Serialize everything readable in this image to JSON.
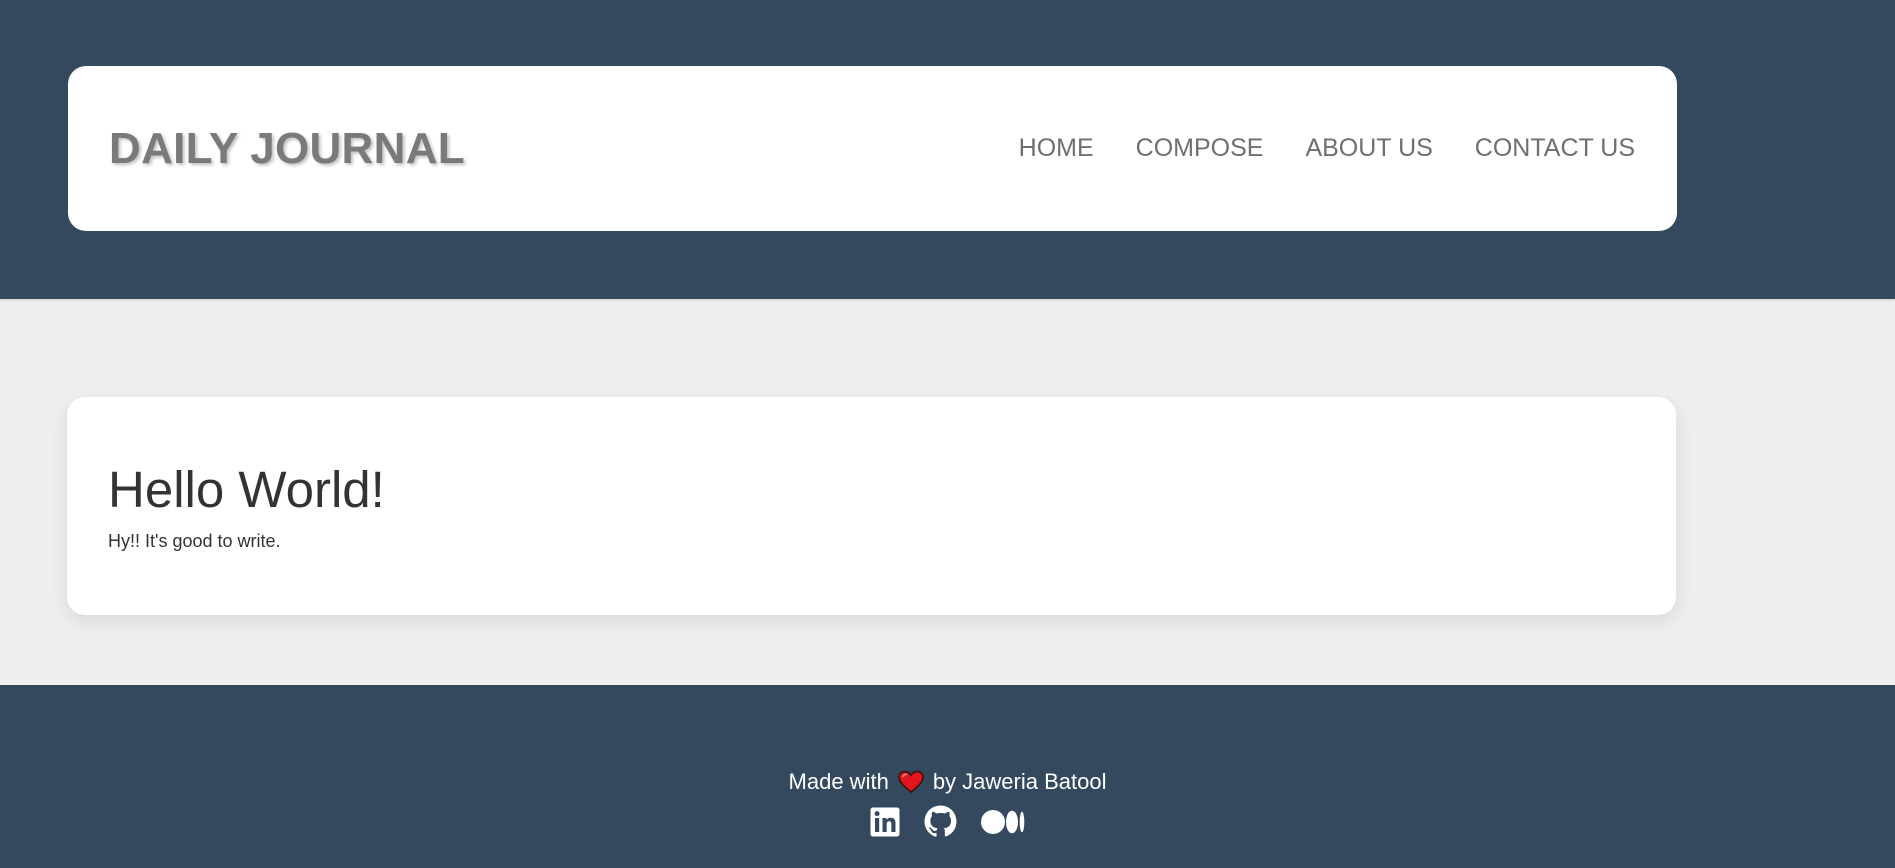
{
  "header": {
    "brand": "DAILY JOURNAL",
    "nav": [
      {
        "label": "HOME"
      },
      {
        "label": "COMPOSE"
      },
      {
        "label": "ABOUT US"
      },
      {
        "label": "CONTACT US"
      }
    ]
  },
  "post": {
    "title": "Hello World!",
    "body": "Hy!! It's good to write."
  },
  "footer": {
    "made_with": "Made with",
    "by_author": "by Jaweria Batool",
    "social_icons": [
      "linkedin-icon",
      "github-icon",
      "medium-icon"
    ]
  },
  "colors": {
    "header_bg": "#35495e",
    "page_bg": "#efefef",
    "card_bg": "#ffffff",
    "brand_text": "#7a7a7a",
    "heart": "#e0161c"
  }
}
